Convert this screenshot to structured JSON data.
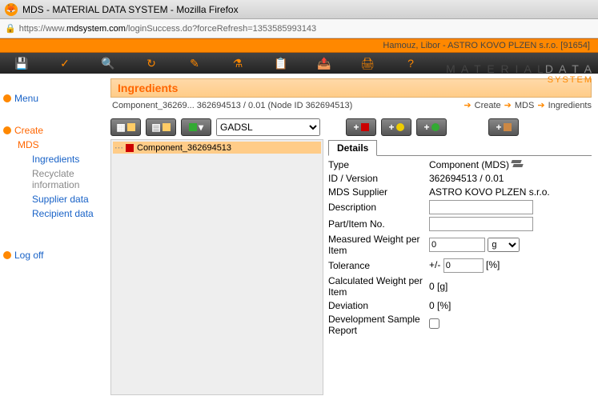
{
  "window": {
    "title": "MDS - MATERIAL DATA SYSTEM - Mozilla Firefox"
  },
  "url": {
    "prefix": "https://www.",
    "domain": "mdsystem.com",
    "path": "/loginSuccess.do?forceRefresh=1353585993143"
  },
  "userbar": {
    "text": "Hamouz, Libor  -  ASTRO KOVO PLZEN s.r.o.  [91654]"
  },
  "brand": {
    "left": "M A T E R I A L",
    "right": "D A T A",
    "sys": "SYSTEM"
  },
  "sidebar": {
    "menu": "Menu",
    "create": "Create",
    "mds": "MDS",
    "ingredients": "Ingredients",
    "recyclate": "Recyclate information",
    "supplier": "Supplier data",
    "recipient": "Recipient data",
    "logoff": "Log off"
  },
  "section": {
    "title": "Ingredients"
  },
  "breadcrumb": {
    "text": "Component_36269... 362694513 / 0.01 (Node ID 362694513)",
    "links": {
      "create": "Create",
      "mds": "MDS",
      "ingredients": "Ingredients"
    }
  },
  "toolbar2": {
    "select_value": "GADSL"
  },
  "tree": {
    "node_label": "Component_362694513"
  },
  "details": {
    "tab": "Details",
    "labels": {
      "type": "Type",
      "id_version": "ID / Version",
      "mds_supplier": "MDS Supplier",
      "description": "Description",
      "part_item": "Part/Item No.",
      "measured_weight": "Measured Weight per Item",
      "tolerance": "Tolerance",
      "calc_weight": "Calculated Weight per Item",
      "deviation": "Deviation",
      "dev_sample": "Development Sample Report"
    },
    "values": {
      "type": "Component (MDS)",
      "id_version": "362694513 / 0.01",
      "mds_supplier": "ASTRO KOVO PLZEN s.r.o.",
      "description": "",
      "part_item": "",
      "measured_weight": "0",
      "measured_unit": "g",
      "tolerance_prefix": "+/-",
      "tolerance": "0",
      "tolerance_unit": "[%]",
      "calc_weight": "0 [g]",
      "deviation": "0 [%]"
    }
  }
}
